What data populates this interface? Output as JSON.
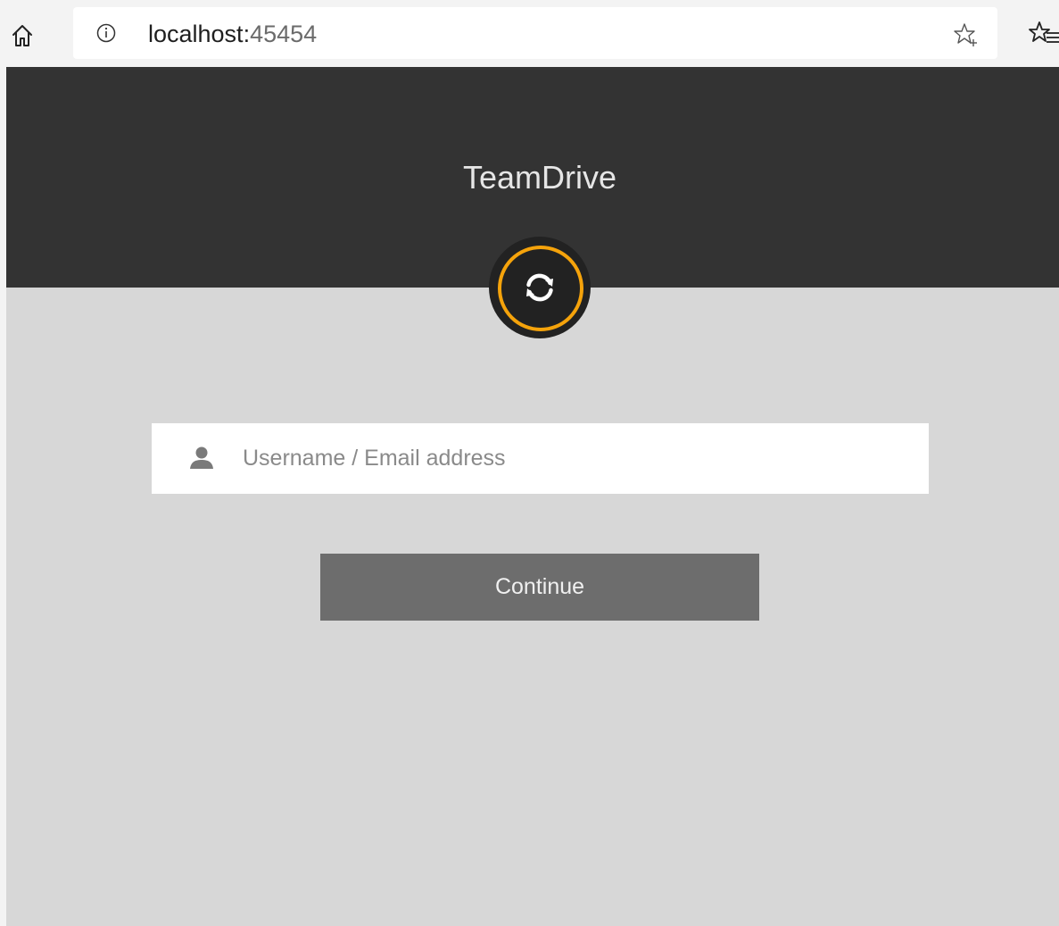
{
  "browser": {
    "url_host": "localhost:",
    "url_port": "45454",
    "icons": {
      "home": "home-icon",
      "info": "info-icon",
      "add_favorite": "star-plus-icon",
      "favorites": "favorites-list-icon"
    }
  },
  "app": {
    "title": "TeamDrive",
    "logo_icon": "sync-icon",
    "accent_color": "#f5a30b",
    "header_color": "#333333",
    "background_color": "#d7d7d7"
  },
  "login": {
    "username_placeholder": "Username / Email address",
    "username_value": "",
    "user_icon": "user-icon",
    "continue_label": "Continue"
  }
}
